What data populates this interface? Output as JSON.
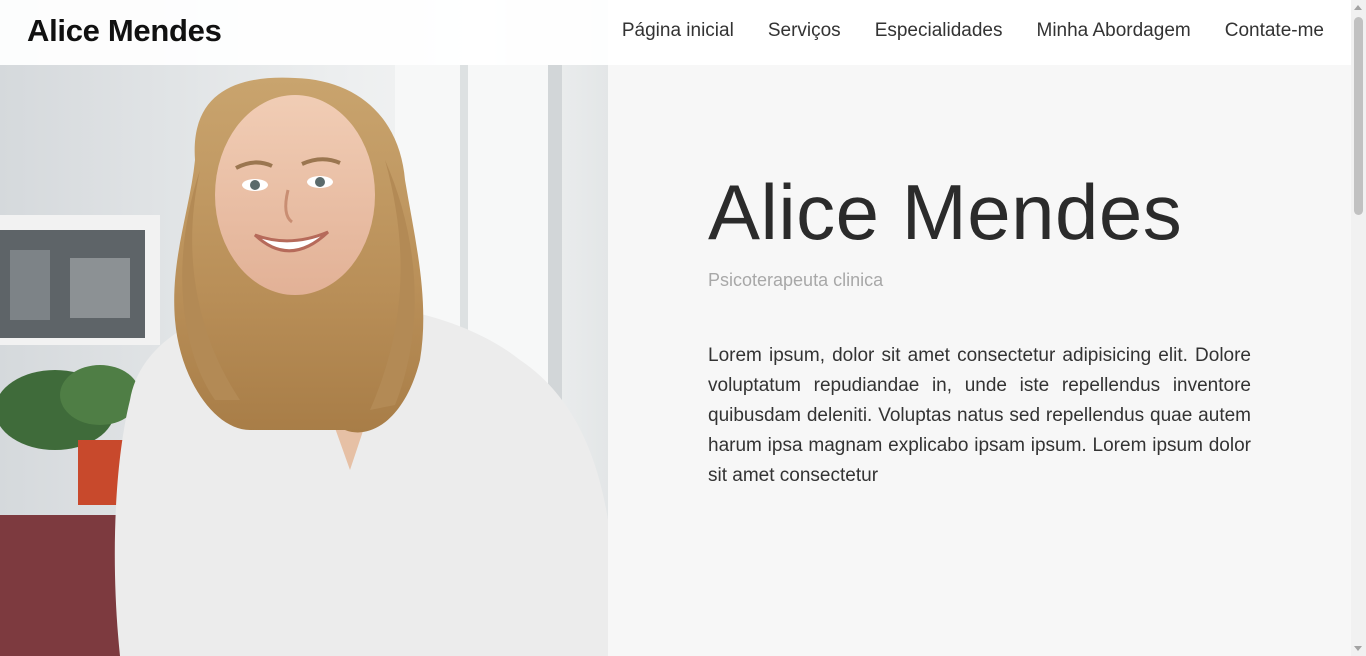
{
  "header": {
    "brand": "Alice Mendes",
    "nav": [
      {
        "label": "Página inicial"
      },
      {
        "label": "Serviços"
      },
      {
        "label": "Especialidades"
      },
      {
        "label": "Minha Abordagem"
      },
      {
        "label": "Contate-me"
      }
    ]
  },
  "hero": {
    "title": "Alice Mendes",
    "subtitle": "Psicoterapeuta clinica",
    "text": "Lorem ipsum, dolor sit amet consectetur adipisicing elit. Dolore voluptatum repudiandae in, unde iste repellendus inventore quibusdam deleniti. Voluptas natus sed repellendus quae autem harum ipsa magnam explicabo ipsam ipsum. Lorem ipsum dolor sit amet consectetur"
  },
  "colors": {
    "background": "#f7f7f7",
    "heading": "#2b2b2b",
    "subtitle": "#a8a8a8",
    "body_text": "#333333",
    "brand_text": "#111111"
  },
  "photo": {
    "subject": "smiling-woman-portrait"
  }
}
